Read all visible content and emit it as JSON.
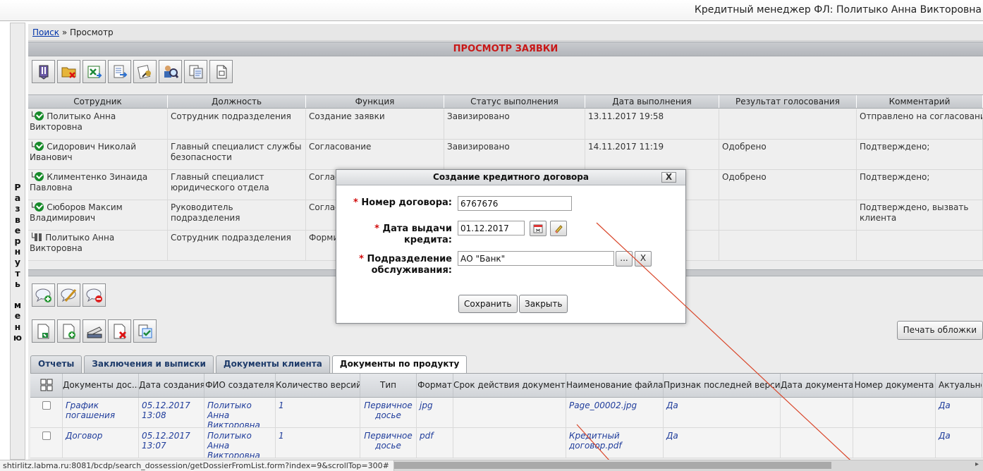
{
  "header": {
    "user": "Кредитный менеджер ФЛ: Политыко Анна Викторовна"
  },
  "left_menu": {
    "label": "Р\nа\nз\nв\nе\nр\nн\nу\nт\nь\n \nм\nе\nн\nю"
  },
  "breadcrumb": {
    "link": "Поиск",
    "separator": " » ",
    "current": "Просмотр"
  },
  "page_title": "ПРОСМОТР ЗАЯВКИ",
  "toolbar_icons": [
    "bookmark-icon",
    "folder-delete-icon",
    "excel-export-icon",
    "document-forward-icon",
    "sign-document-icon",
    "search-person-icon",
    "copy-document-icon",
    "page-icon"
  ],
  "approval_grid": {
    "columns": [
      "Сотрудник",
      "Должность",
      "Функция",
      "Статус выполнения",
      "Дата выполнения",
      "Результат голосования",
      "Комментарий"
    ],
    "rows": [
      {
        "status": "done",
        "employee": "Политыко Анна Викторовна",
        "position": "Сотрудник подразделения",
        "function": "Создание заявки",
        "state": "Завизировано",
        "date": "13.11.2017 19:58",
        "vote": "",
        "comment": "Отправлено на согласование;"
      },
      {
        "status": "done",
        "employee": "Сидорович Николай Иванович",
        "position": "Главный специалист службы безопасности",
        "function": "Согласование",
        "state": "Завизировано",
        "date": "14.11.2017 11:19",
        "vote": "Одобрено",
        "comment": "Подтверждено;"
      },
      {
        "status": "done",
        "employee": "Климентенко Зинаида Павловна",
        "position": "Главный специалист юридического отдела",
        "function": "Соглас",
        "state": "",
        "date": "",
        "vote": "Одобрено",
        "comment": "Подтверждено;"
      },
      {
        "status": "done",
        "employee": "Сюборов Максим Владимирович",
        "position": "Руководитель подразделения",
        "function": "Соглас",
        "state": "",
        "date": "",
        "vote": "",
        "comment": "Подтверждено, вызвать клиента"
      },
      {
        "status": "pending",
        "employee": "Политыко Анна Викторовна",
        "position": "Сотрудник подразделения",
        "function": "Форми",
        "state": "",
        "date": "",
        "vote": "",
        "comment": ""
      }
    ]
  },
  "comment_icons": [
    "comment-add-icon",
    "comment-edit-icon",
    "comment-delete-icon"
  ],
  "doc_icons": [
    "document-import-icon",
    "document-add-icon",
    "scanner-icon",
    "document-delete-icon",
    "document-approve-icon"
  ],
  "print_cover_button": "Печать обложки",
  "tabs": [
    "Отчеты",
    "Заключения и выписки",
    "Документы клиента",
    "Документы по продукту"
  ],
  "active_tab": 3,
  "documents_grid": {
    "columns": [
      "",
      "Документы дос...",
      "Дата создания",
      "ФИО создателя",
      "Количество версий",
      "Тип",
      "Формат",
      "Срок действия документа",
      "Наименование файла",
      "Признак последней версии",
      "Дата документа",
      "Номер документа",
      "Актуальность"
    ],
    "rows": [
      {
        "doc": "График погашения",
        "created": "05.12.2017 13:08",
        "creator": "Политыко Анна Викторовна",
        "versions": "1",
        "type": "Первичное досье",
        "format": "jpg",
        "validity": "",
        "file": "Page_00002.jpg",
        "latest": "Да",
        "doc_date": "",
        "doc_number": "",
        "actual": "Да"
      },
      {
        "doc": "Договор",
        "created": "05.12.2017 13:07",
        "creator": "Политыко Анна Викторовна",
        "versions": "1",
        "type": "Первичное досье",
        "format": "pdf",
        "validity": "",
        "file": "Кредитный договор.pdf",
        "latest": "Да",
        "doc_date": "",
        "doc_number": "",
        "actual": "Да"
      }
    ]
  },
  "dialog": {
    "title": "Создание кредитного договора",
    "close": "X",
    "contract_number_label": "Номер договора:",
    "contract_number_value": "6767676",
    "issue_date_label_1": "Дата выдачи",
    "issue_date_label_2": "кредита:",
    "issue_date_value": "01.12.2017",
    "unit_label_1": "Подразделение",
    "unit_label_2": "обслуживания:",
    "unit_value": "АО \"Банк\"",
    "browse_button": "...",
    "clear_button": "X",
    "save_button": "Сохранить",
    "close_button": "Закрыть",
    "required_mark": "*"
  },
  "status_bar": {
    "url": "shtirlitz.labma.ru:8081/bcdp/search_dossession/getDossierFromList.form?index=9&scrollTop=300#"
  },
  "colors": {
    "title_red": "#c81818",
    "required_red": "#d10a0a",
    "link_blue": "#0033aa",
    "check_green": "#178a2a",
    "annotation_line": "#d9462a"
  }
}
